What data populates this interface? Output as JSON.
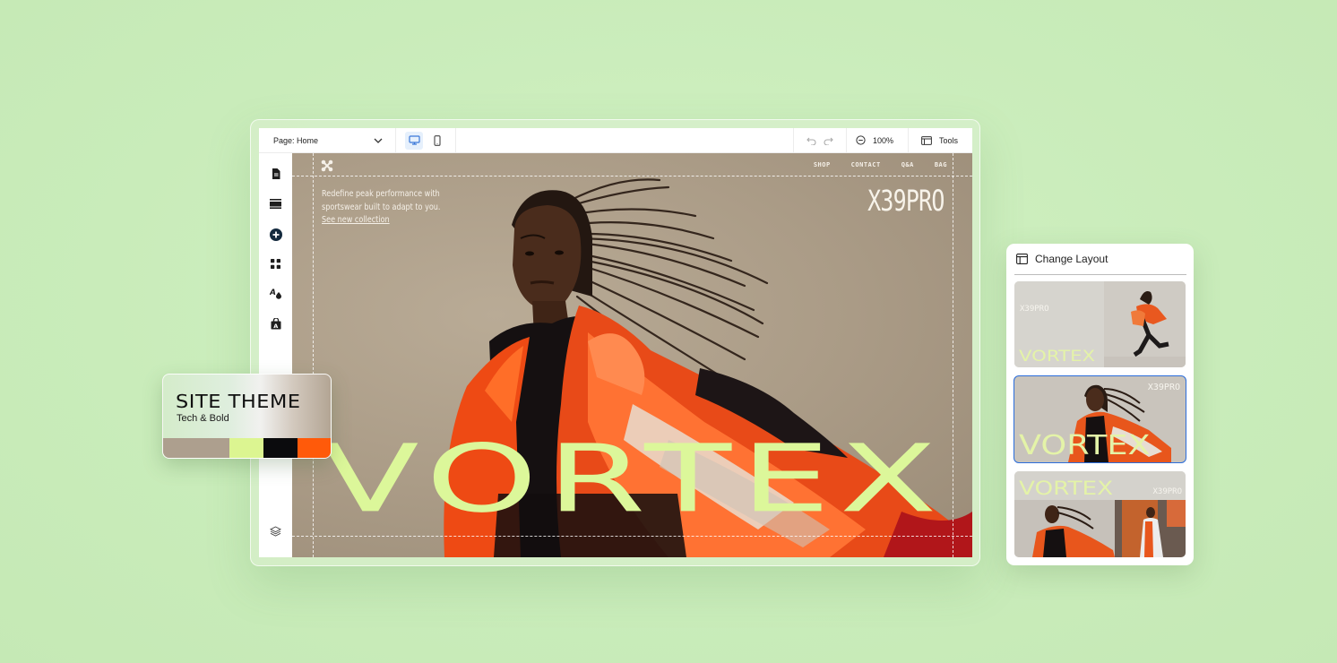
{
  "editor": {
    "page_select": {
      "label": "Page: Home",
      "icon": "chevron-down-icon"
    },
    "devices": [
      {
        "name": "desktop",
        "icon": "desktop-icon",
        "active": true
      },
      {
        "name": "mobile",
        "icon": "mobile-icon",
        "active": false
      }
    ],
    "history": {
      "undo_icon": "undo-icon",
      "redo_icon": "redo-icon"
    },
    "zoom": {
      "icon": "zoom-out-icon",
      "value": "100%"
    },
    "tools": {
      "icon": "tools-panel-icon",
      "label": "Tools"
    },
    "sidebar": [
      {
        "name": "pages",
        "icon": "page-icon"
      },
      {
        "name": "sections",
        "icon": "sections-icon"
      },
      {
        "name": "add",
        "icon": "add-circle-icon"
      },
      {
        "name": "apps",
        "icon": "apps-grid-icon"
      },
      {
        "name": "theme",
        "icon": "design-fonts-icon"
      },
      {
        "name": "media",
        "icon": "text-bag-icon"
      },
      {
        "name": "layers",
        "icon": "layers-icon"
      }
    ]
  },
  "site": {
    "nav": [
      "SHOP",
      "CONTACT",
      "Q&A",
      "BAG"
    ],
    "tagline": "Redefine peak performance with sportswear built to adapt to you.",
    "link": "See new collection",
    "brand": "X39PRO",
    "headline": "VORTEX",
    "logo_icon": "x-logo-icon"
  },
  "theme_card": {
    "title": "SITE THEME",
    "subtitle": "Tech & Bold",
    "swatches": [
      "#ad9f8e",
      "#dcf591",
      "#0b0b0d",
      "#ff5a0a"
    ]
  },
  "layout_panel": {
    "title": "Change Layout",
    "icon": "layout-icon",
    "options": [
      {
        "name": "split-layout",
        "headline": "VORTEX",
        "brand": "X39PRO",
        "selected": false
      },
      {
        "name": "hero-layout",
        "headline": "VORTEX",
        "brand": "X39PRO",
        "selected": true
      },
      {
        "name": "stacked-layout",
        "headline": "VORTEX",
        "brand": "X39PRO",
        "selected": false
      }
    ]
  },
  "colors": {
    "background": "#c9ecba",
    "accent_lime": "#dcf79a",
    "accent_orange": "#ff5a0a",
    "selection_blue": "#2b6ddb"
  }
}
